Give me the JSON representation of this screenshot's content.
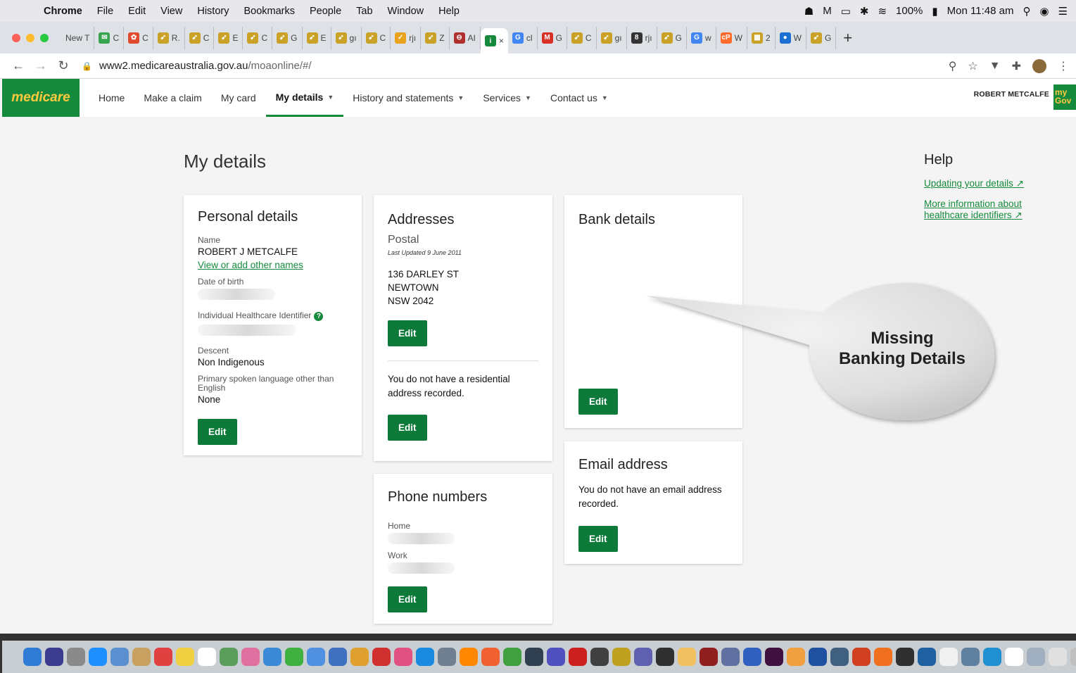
{
  "menubar": {
    "app": "Chrome",
    "items": [
      "File",
      "Edit",
      "View",
      "History",
      "Bookmarks",
      "People",
      "Tab",
      "Window",
      "Help"
    ],
    "battery": "100%",
    "clock": "Mon 11:48 am"
  },
  "tabs": [
    {
      "label": "New T",
      "fav": "",
      "color": "#dee1e6"
    },
    {
      "label": "C",
      "fav": "✉",
      "color": "#3aa34f"
    },
    {
      "label": "C",
      "fav": "✿",
      "color": "#e04a2f"
    },
    {
      "label": "R.",
      "fav": "➹",
      "color": "#c9a227"
    },
    {
      "label": "C",
      "fav": "➹",
      "color": "#c9a227"
    },
    {
      "label": "E",
      "fav": "➹",
      "color": "#c9a227"
    },
    {
      "label": "C",
      "fav": "➹",
      "color": "#c9a227"
    },
    {
      "label": "G",
      "fav": "➹",
      "color": "#c9a227"
    },
    {
      "label": "E",
      "fav": "➹",
      "color": "#c9a227"
    },
    {
      "label": "gı",
      "fav": "➹",
      "color": "#c9a227"
    },
    {
      "label": "C",
      "fav": "➹",
      "color": "#c9a227"
    },
    {
      "label": "rjı",
      "fav": "✓",
      "color": "#e8a21c"
    },
    {
      "label": "Z",
      "fav": "➹",
      "color": "#c9a227"
    },
    {
      "label": "AI",
      "fav": "⊖",
      "color": "#b03030"
    },
    {
      "label": "×",
      "fav": "i",
      "color": "#168a3c",
      "active": true
    },
    {
      "label": "cl",
      "fav": "G",
      "color": "#4285f4"
    },
    {
      "label": "G",
      "fav": "M",
      "color": "#d93025"
    },
    {
      "label": "C",
      "fav": "➹",
      "color": "#c9a227"
    },
    {
      "label": "gı",
      "fav": "➹",
      "color": "#c9a227"
    },
    {
      "label": "rjı",
      "fav": "8",
      "color": "#333333"
    },
    {
      "label": "G",
      "fav": "➹",
      "color": "#c9a227"
    },
    {
      "label": "w",
      "fav": "G",
      "color": "#4285f4"
    },
    {
      "label": "W",
      "fav": "cP",
      "color": "#ff6c2c"
    },
    {
      "label": "2",
      "fav": "▦",
      "color": "#c9a227"
    },
    {
      "label": "W",
      "fav": "●",
      "color": "#1d6fd1"
    },
    {
      "label": "G",
      "fav": "➹",
      "color": "#c9a227"
    }
  ],
  "address": {
    "domain": "www2.medicareaustralia.gov.au",
    "path": "/moaonline/#/"
  },
  "site": {
    "logo": "medicare",
    "nav": [
      {
        "label": "Home",
        "dropdown": false
      },
      {
        "label": "Make a claim",
        "dropdown": false
      },
      {
        "label": "My card",
        "dropdown": false
      },
      {
        "label": "My details",
        "dropdown": true,
        "active": true
      },
      {
        "label": "History and statements",
        "dropdown": true
      },
      {
        "label": "Services",
        "dropdown": true
      },
      {
        "label": "Contact us",
        "dropdown": true
      }
    ],
    "user": "ROBERT METCALFE",
    "mygov_top": "my",
    "mygov_bottom": "Gov"
  },
  "page": {
    "title": "My details"
  },
  "personal": {
    "heading": "Personal details",
    "name_label": "Name",
    "name_value": "ROBERT J METCALFE",
    "other_names_link": "View or add other names",
    "dob_label": "Date of birth",
    "ihi_label": "Individual Healthcare Identifier",
    "descent_label": "Descent",
    "descent_value": "Non Indigenous",
    "language_label": "Primary spoken language other than English",
    "language_value": "None",
    "edit": "Edit"
  },
  "addresses": {
    "heading": "Addresses",
    "postal_heading": "Postal",
    "last_updated": "Last Updated 9 June 2011",
    "line1": "136 DARLEY ST",
    "line2": "NEWTOWN",
    "line3": "NSW 2042",
    "edit": "Edit",
    "residential_text": "You do not have a residential address recorded.",
    "edit2": "Edit"
  },
  "phones": {
    "heading": "Phone numbers",
    "home_label": "Home",
    "work_label": "Work",
    "edit": "Edit"
  },
  "bank": {
    "heading": "Bank details",
    "edit": "Edit"
  },
  "email": {
    "heading": "Email address",
    "text": "You do not have an email address recorded.",
    "edit": "Edit"
  },
  "help": {
    "heading": "Help",
    "link1": "Updating your details",
    "link2": "More information about healthcare identifiers"
  },
  "callout": {
    "line1": "Missing",
    "line2": "Banking Details"
  },
  "colors": {
    "brand_green": "#168a3c",
    "button_green": "#0e7a3a",
    "logo_yellow": "#ffc93e"
  }
}
